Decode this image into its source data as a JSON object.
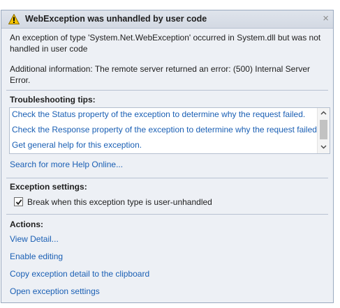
{
  "dialog": {
    "title": "WebException was unhandled by user code",
    "close_glyph": "×",
    "message": "An exception of type 'System.Net.WebException' occurred in System.dll but was not handled in user code",
    "additional_info": "Additional information: The remote server returned an error: (500) Internal Server Error."
  },
  "troubleshooting": {
    "heading": "Troubleshooting tips:",
    "tips": [
      "Check the Status property of the exception to determine why the request failed.",
      "Check the Response property of the exception to determine why the request failed.",
      "Get general help for this exception."
    ],
    "search_link": "Search for more Help Online..."
  },
  "exception_settings": {
    "heading": "Exception settings:",
    "checkbox_label": "Break when this exception type is user-unhandled",
    "checked": true
  },
  "actions": {
    "heading": "Actions:",
    "items": [
      "View Detail...",
      "Enable editing",
      "Copy exception detail to the clipboard",
      "Open exception settings"
    ]
  },
  "icons": {
    "warning": "warning-icon",
    "close": "close-icon",
    "check": "check-icon",
    "scroll_up": "scroll-up-arrow-icon",
    "scroll_down": "scroll-down-arrow-icon"
  },
  "colors": {
    "link": "#1a5fb4",
    "dialog_bg": "#edf0f5",
    "warning_fill": "#f5c400"
  }
}
